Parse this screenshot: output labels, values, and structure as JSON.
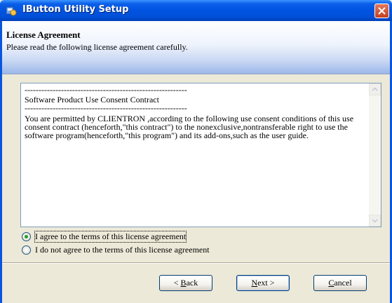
{
  "window": {
    "title": "IButton Utility Setup",
    "close_icon": "close-icon",
    "app_icon": "setup-icon"
  },
  "header": {
    "title": "License Agreement",
    "subtitle": "Please read the following license agreement carefully."
  },
  "license": {
    "rule1": "----------------------------------------------------------",
    "heading": "Software Product Use Consent Contract",
    "rule2": "----------------------------------------------------------",
    "body": "You are permitted by CLIENTRON ,according to the following use consent conditions of this use consent contract (henceforth,\"this contract\") to the nonexclusive,nontransferable right to use the software program(henceforth,\"this program\") and its add-ons,such as the user guide."
  },
  "options": {
    "agree": "I agree to the terms of this license agreement",
    "disagree": "I do not agree to the terms of this license agreement",
    "selected": "agree"
  },
  "buttons": {
    "back": {
      "mnemonic": "B",
      "rest": "ack",
      "prefix": "< "
    },
    "next": {
      "mnemonic": "N",
      "rest": "ext",
      "suffix": " >"
    },
    "cancel": {
      "mnemonic": "C",
      "rest": "ancel"
    }
  },
  "colors": {
    "titlebar": "#0053e1",
    "dialog_bg": "#ece9d8",
    "radio_dot": "#21a121"
  }
}
